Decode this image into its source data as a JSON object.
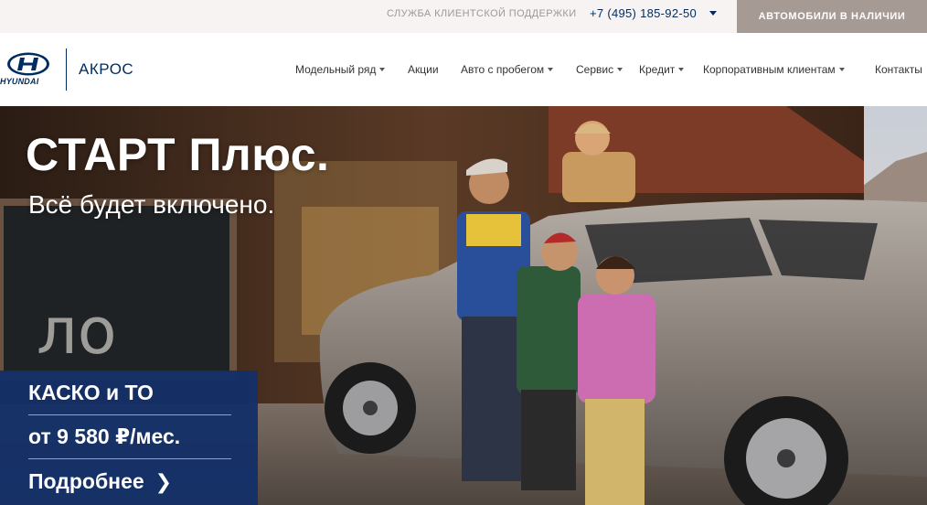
{
  "topbar": {
    "support_label": "СЛУЖБА КЛИЕНТСКОЙ ПОДДЕРЖКИ",
    "phone": "+7 (495) 185-92-50",
    "stock_button": "АВТОМОБИЛИ В НАЛИЧИИ"
  },
  "header": {
    "brand": "HYUNDAI",
    "dealer": "АКРОС",
    "nav": [
      {
        "label": "Модельный ряд",
        "dropdown": true
      },
      {
        "label": "Акции",
        "dropdown": false
      },
      {
        "label": "Авто с пробегом",
        "dropdown": true
      },
      {
        "label": "Сервис",
        "dropdown": true
      },
      {
        "label": "Кредит",
        "dropdown": true
      },
      {
        "label": "Корпоративным клиентам",
        "dropdown": true
      },
      {
        "label": "Контакты",
        "dropdown": false
      }
    ]
  },
  "hero": {
    "title": "СТАРТ Плюс.",
    "subtitle": "Всё будет включено.",
    "promo": {
      "line1": "КАСКО и ТО",
      "line2": "от 9 580 ₽/мес.",
      "more": "Подробнее",
      "more_chevron": "❯"
    }
  },
  "colors": {
    "brand_blue": "#002c5f",
    "promo_bg": "#143068",
    "stock_button_bg": "#a69b94",
    "topbar_bg": "#f6f3f2"
  }
}
